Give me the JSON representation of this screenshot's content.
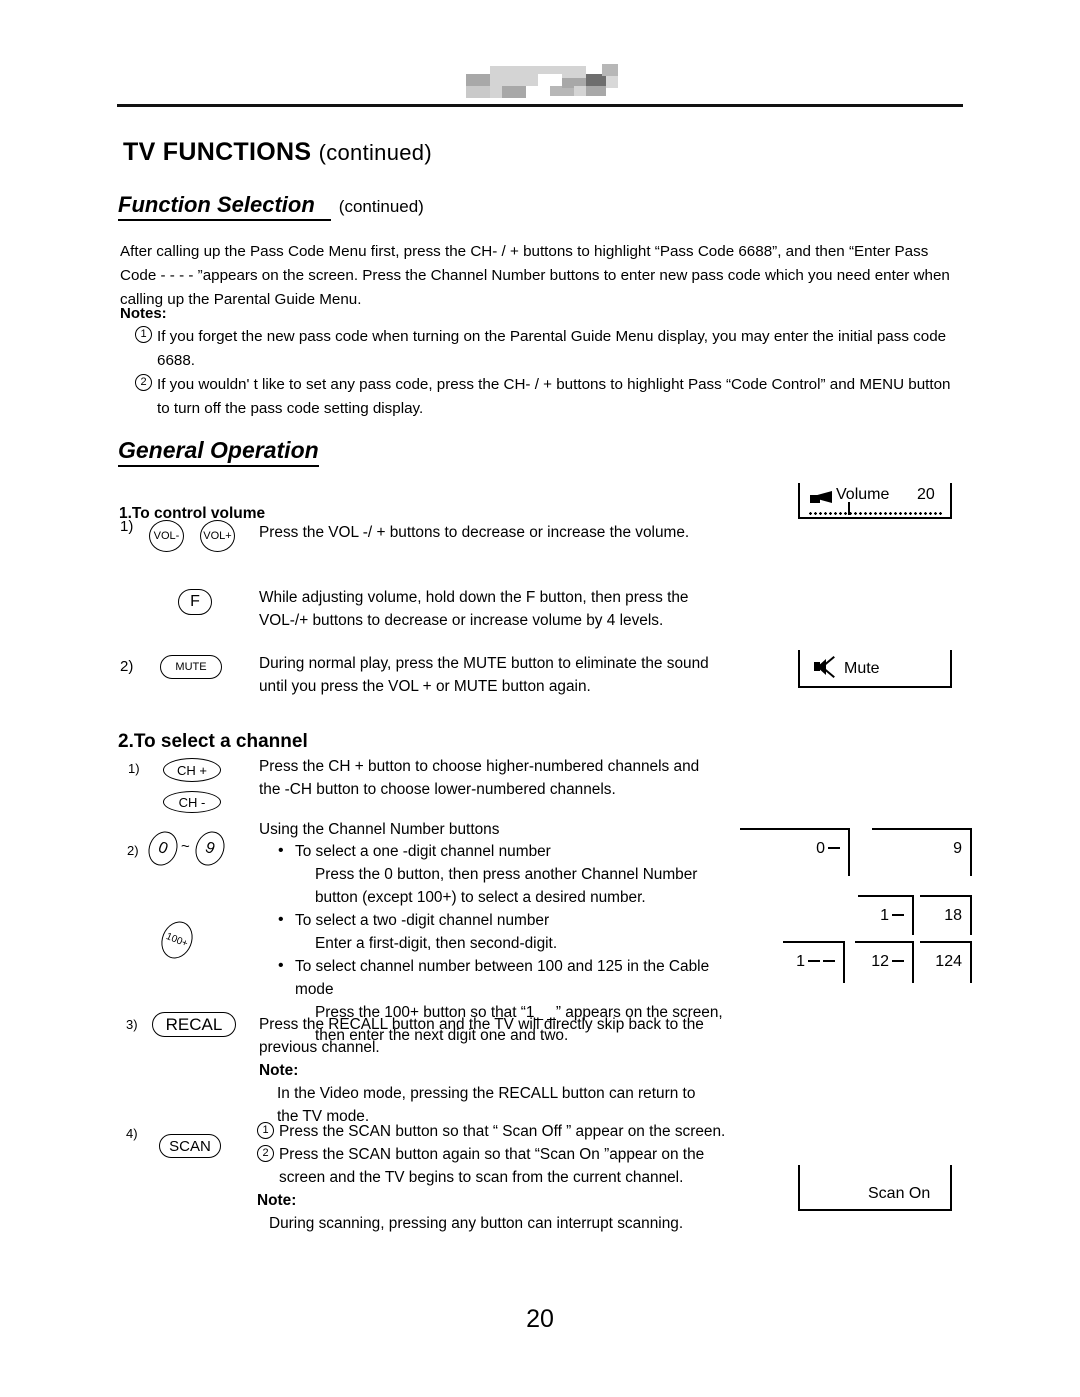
{
  "document": {
    "title_main": "TV FUNCTIONS",
    "title_continued": "(continued)",
    "page_number": "20"
  },
  "section_function_selection": {
    "heading": "Function Selection",
    "heading_continued": "(continued)",
    "intro_paragraph": "After calling up the Pass Code Menu first, press the CH- / + buttons to highlight “Pass Code 6688”, and then “Enter Pass Code -  -  -  - ”appears on the screen. Press the Channel Number buttons to enter new pass code which you need enter when calling up the Parental Guide Menu.",
    "notes_label": "Notes:",
    "notes": [
      {
        "marker": "1",
        "text": "If you forget the new pass code when turning on the Parental Guide Menu display, you may enter the initial pass code 6688."
      },
      {
        "marker": "2",
        "text": "If you wouldn' t like to set any pass code, press the CH- / +  buttons to highlight Pass “Code Control” and MENU button to turn off the pass code setting display."
      }
    ]
  },
  "section_general_operation": {
    "heading": "General Operation",
    "volume": {
      "sub_heading": "1.To control volume",
      "step1_num": "1)",
      "btn_vol_minus": "VOL-",
      "btn_vol_plus": "VOL+",
      "step1_text": "Press the  VOL -/ +  buttons to decrease or increase the volume.",
      "btn_f": "F",
      "f_text": "While adjusting volume, hold down the F button, then press the VOL-/+ buttons to decrease or increase volume by 4 levels.",
      "step2_num": "2)",
      "btn_mute": "MUTE",
      "step2_text": "During normal play, press the MUTE button to eliminate the sound until you press the VOL +  or MUTE  button again.",
      "osd_volume_label": "Volume",
      "osd_volume_value": "20",
      "osd_mute_label": "Mute"
    },
    "channel": {
      "sub_heading": "2.To select a channel",
      "step1_num": "1)",
      "btn_ch_plus": "CH +",
      "btn_ch_minus": "CH -",
      "step1_text": "Press the CH + button to choose higher-numbered channels and the -CH button to choose lower-numbered channels.",
      "step2_num": "2)",
      "btn_zero": "0",
      "btn_tilde": "~",
      "btn_nine": "9",
      "btn_100plus": "100+",
      "number_intro": "Using the Channel Number buttons",
      "bullets": [
        {
          "head": "To select a one -digit channel number",
          "body": "Press the 0 button, then press another Channel Number button (except 100+) to select a desired number."
        },
        {
          "head": "To select a two -digit channel number",
          "body": "Enter a first-digit, then second-digit."
        },
        {
          "head": "To select channel number between 100 and 125 in the Cable mode",
          "body": "Press the 100+ button so that “1_ _” appears on the screen, then enter the next digit one and two."
        }
      ],
      "step3_num": "3)",
      "btn_recall": "RECAL",
      "step3_text": "Press the RECALL button and the TV will directly skip back to the previous channel.",
      "step3_note_label": "Note:",
      "step3_note_text": "In the Video mode,  pressing the RECALL button can return to the TV  mode.",
      "step4_num": "4)",
      "btn_scan": "SCAN",
      "step4_items": [
        {
          "marker": "1",
          "text": "Press the SCAN button so that “ Scan Off ” appear on the screen."
        },
        {
          "marker": "2",
          "text": "Press the SCAN button again so that “Scan On ”appear on the screen and the TV begins to scan from the current channel."
        }
      ],
      "step4_note_label": "Note:",
      "step4_note_text": "During scanning, pressing any button can interrupt scanning.",
      "osd_scan_label": "Scan On",
      "channel_displays": [
        {
          "value": "0",
          "dashes": 1
        },
        {
          "value": "9",
          "dashes": 0
        },
        {
          "value": "1",
          "dashes": 1
        },
        {
          "value": "18",
          "dashes": 0
        },
        {
          "value": "1",
          "dashes": 2
        },
        {
          "value": "12",
          "dashes": 1
        },
        {
          "value": "124",
          "dashes": 0
        }
      ]
    }
  },
  "colors": {
    "ink": "#000000",
    "paper": "#ffffff",
    "logo_gray_light": "#d4d4d4",
    "logo_gray_mid": "#a8a8a8",
    "logo_gray_dark": "#6e6e6e"
  }
}
